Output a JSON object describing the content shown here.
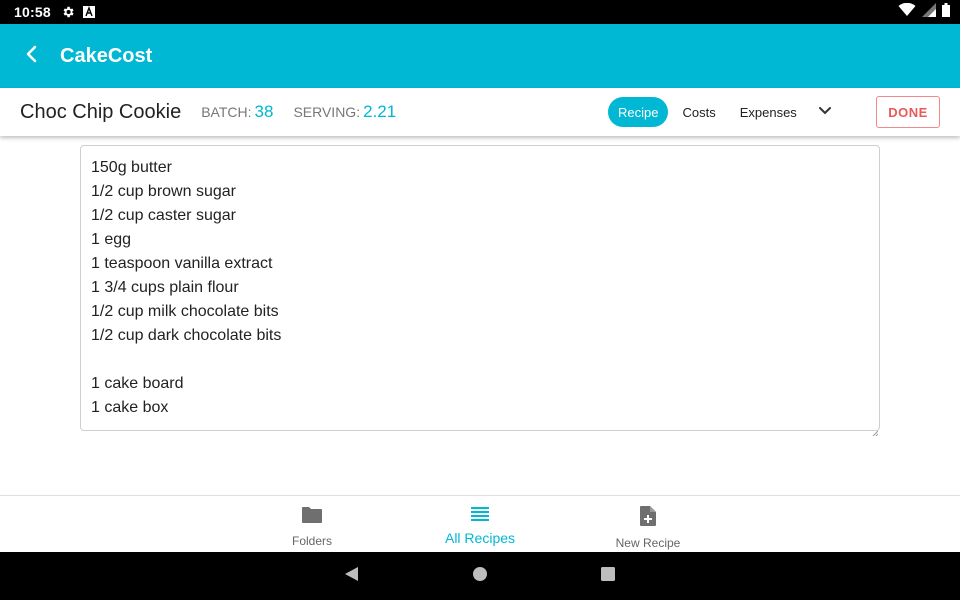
{
  "status_bar": {
    "time": "10:58",
    "icons": [
      "gear-icon",
      "font-a-icon",
      "wifi-icon",
      "signal-icon",
      "battery-icon"
    ]
  },
  "app_bar": {
    "title": "CakeCost",
    "back_icon": "arrow-back-icon",
    "color": "#00b8d4"
  },
  "recipe_header": {
    "name": "Choc Chip Cookie",
    "batch_label": "BATCH:",
    "batch_value": "38",
    "serving_label": "SERVING:",
    "serving_value": "2.21",
    "tabs": [
      {
        "label": "Recipe",
        "active": true
      },
      {
        "label": "Costs",
        "active": false
      },
      {
        "label": "Expenses",
        "active": false
      }
    ],
    "more_icon": "chevron-down-icon",
    "done_label": "DONE",
    "done_color": "#e85a5a"
  },
  "editor": {
    "lines": [
      "150g butter",
      "1/2 cup brown sugar",
      "1/2 cup caster sugar",
      "1 egg",
      "1 teaspoon vanilla extract",
      "1 3/4 cups plain flour",
      "1/2 cup milk chocolate bits",
      "1/2 cup dark chocolate bits",
      "",
      "1 cake board",
      "1 cake box"
    ]
  },
  "bottom_nav": {
    "items": [
      {
        "label": "Folders",
        "icon": "folder-icon",
        "active": false
      },
      {
        "label": "All Recipes",
        "icon": "list-icon",
        "active": true
      },
      {
        "label": "New Recipe",
        "icon": "add-document-icon",
        "active": false
      }
    ]
  },
  "system_nav": {
    "buttons": [
      "back-triangle-icon",
      "home-circle-icon",
      "recents-square-icon"
    ]
  }
}
